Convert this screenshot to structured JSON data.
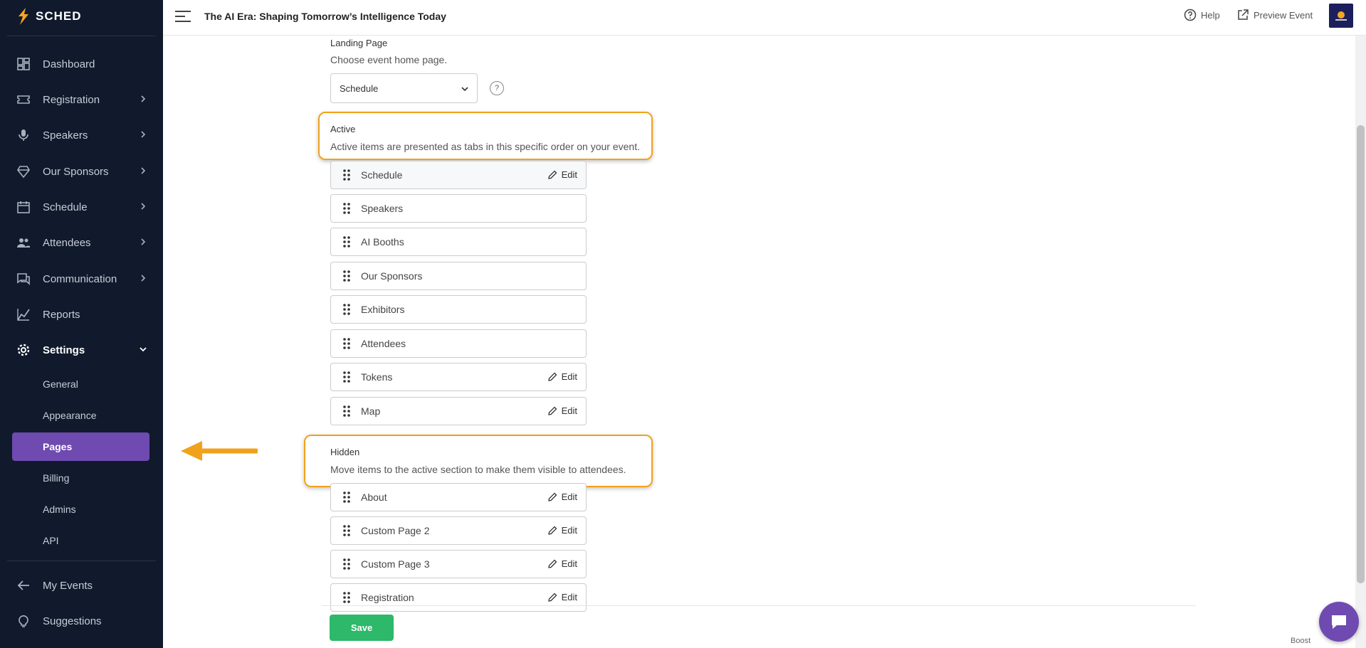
{
  "app": {
    "logo_text": "SCHED"
  },
  "header": {
    "event_title": "The AI Era: Shaping Tomorrow’s Intelligence Today",
    "help_label": "Help",
    "preview_label": "Preview Event"
  },
  "sidebar": {
    "items": [
      {
        "label": "Dashboard",
        "icon": "dashboard-icon"
      },
      {
        "label": "Registration",
        "icon": "ticket-icon"
      },
      {
        "label": "Speakers",
        "icon": "microphone-icon"
      },
      {
        "label": "Our Sponsors",
        "icon": "diamond-icon"
      },
      {
        "label": "Schedule",
        "icon": "calendar-icon"
      },
      {
        "label": "Attendees",
        "icon": "people-icon"
      },
      {
        "label": "Communication",
        "icon": "chat-icon"
      },
      {
        "label": "Reports",
        "icon": "chart-icon"
      },
      {
        "label": "Settings",
        "icon": "gear-icon"
      }
    ],
    "settings_sub": [
      "General",
      "Appearance",
      "Pages",
      "Billing",
      "Admins",
      "API"
    ],
    "selected_sub": "Pages",
    "bottom": [
      {
        "label": "My Events",
        "icon": "arrow-left-icon"
      },
      {
        "label": "Suggestions",
        "icon": "lightbulb-icon"
      }
    ]
  },
  "landing": {
    "label": "Landing Page",
    "description": "Choose event home page.",
    "selected": "Schedule",
    "help_glyph": "?"
  },
  "active": {
    "title": "Active",
    "description": "Active items are presented as tabs in this specific order on your event.",
    "items": [
      {
        "name": "Schedule",
        "edit": "Edit"
      },
      {
        "name": "Speakers",
        "edit": ""
      },
      {
        "name": "AI Booths",
        "edit": ""
      },
      {
        "name": "Our Sponsors",
        "edit": ""
      },
      {
        "name": "Exhibitors",
        "edit": ""
      },
      {
        "name": "Attendees",
        "edit": ""
      },
      {
        "name": "Tokens",
        "edit": "Edit"
      },
      {
        "name": "Map",
        "edit": "Edit"
      }
    ]
  },
  "hidden": {
    "title": "Hidden",
    "description": "Move items to the active section to make them visible to attendees.",
    "items": [
      {
        "name": "About",
        "edit": "Edit"
      },
      {
        "name": "Custom Page 2",
        "edit": "Edit"
      },
      {
        "name": "Custom Page 3",
        "edit": "Edit"
      },
      {
        "name": "Registration",
        "edit": "Edit"
      }
    ]
  },
  "footer": {
    "save_label": "Save",
    "boost_label": "Boost"
  },
  "colors": {
    "sidebar_bg": "#101a2c",
    "accent": "#6f4ab0",
    "highlight": "#f0a21b",
    "save": "#2db86a"
  }
}
